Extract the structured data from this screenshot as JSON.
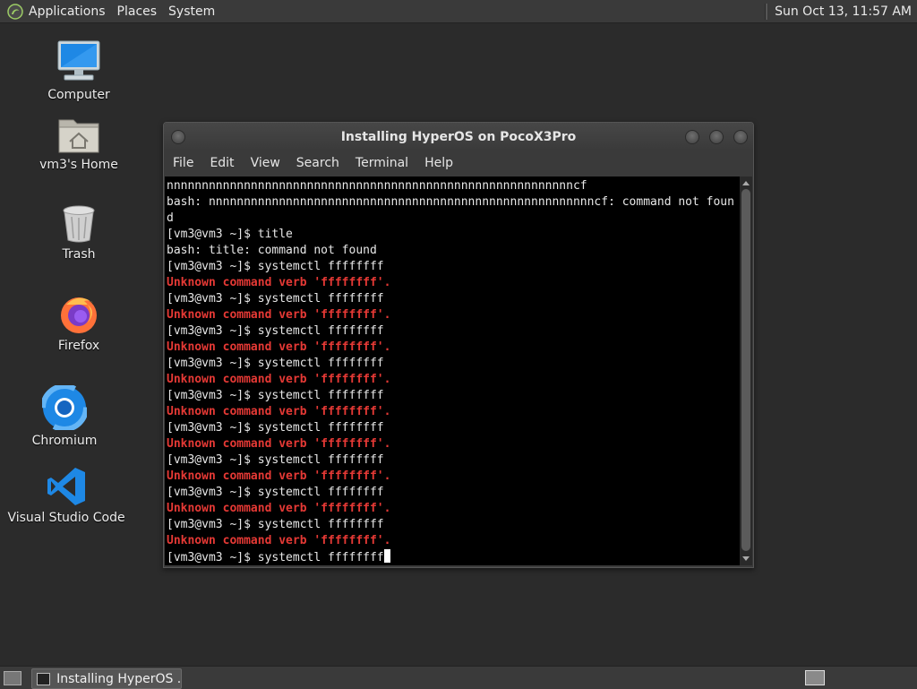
{
  "top_panel": {
    "menus": [
      "Applications",
      "Places",
      "System"
    ],
    "clock": "Sun Oct 13, 11:57 AM"
  },
  "desktop": {
    "icons": [
      {
        "label": "Computer",
        "icon": "computer-icon"
      },
      {
        "label": "vm3's Home",
        "icon": "home-folder-icon"
      },
      {
        "label": "Trash",
        "icon": "trash-icon"
      },
      {
        "label": "Firefox",
        "icon": "firefox-icon"
      },
      {
        "label": "Chromium",
        "icon": "chromium-icon"
      },
      {
        "label": "Visual Studio Code",
        "icon": "vscode-icon"
      }
    ]
  },
  "terminal": {
    "title": "Installing HyperOS on PocoX3Pro",
    "menu": [
      "File",
      "Edit",
      "View",
      "Search",
      "Terminal",
      "Help"
    ],
    "lines": [
      {
        "text": "nnnnnnnnnnnnnnnnnnnnnnnnnnnnnnnnnnnnnnnnnnnnnnnnnnnnnnnnnncf",
        "style": "normal"
      },
      {
        "text": "bash: nnnnnnnnnnnnnnnnnnnnnnnnnnnnnnnnnnnnnnnnnnnnnnnnnnnnnnncf: command not foun",
        "style": "normal"
      },
      {
        "text": "d",
        "style": "normal"
      },
      {
        "text": "[vm3@vm3 ~]$ title",
        "style": "normal"
      },
      {
        "text": "bash: title: command not found",
        "style": "normal"
      },
      {
        "text": "[vm3@vm3 ~]$ systemctl ffffffff",
        "style": "normal"
      },
      {
        "text": "Unknown command verb 'ffffffff'.",
        "style": "error"
      },
      {
        "text": "[vm3@vm3 ~]$ systemctl ffffffff",
        "style": "normal"
      },
      {
        "text": "Unknown command verb 'ffffffff'.",
        "style": "error"
      },
      {
        "text": "[vm3@vm3 ~]$ systemctl ffffffff",
        "style": "normal"
      },
      {
        "text": "Unknown command verb 'ffffffff'.",
        "style": "error"
      },
      {
        "text": "[vm3@vm3 ~]$ systemctl ffffffff",
        "style": "normal"
      },
      {
        "text": "Unknown command verb 'ffffffff'.",
        "style": "error"
      },
      {
        "text": "[vm3@vm3 ~]$ systemctl ffffffff",
        "style": "normal"
      },
      {
        "text": "Unknown command verb 'ffffffff'.",
        "style": "error"
      },
      {
        "text": "[vm3@vm3 ~]$ systemctl ffffffff",
        "style": "normal"
      },
      {
        "text": "Unknown command verb 'ffffffff'.",
        "style": "error"
      },
      {
        "text": "[vm3@vm3 ~]$ systemctl ffffffff",
        "style": "normal"
      },
      {
        "text": "Unknown command verb 'ffffffff'.",
        "style": "error"
      },
      {
        "text": "[vm3@vm3 ~]$ systemctl ffffffff",
        "style": "normal"
      },
      {
        "text": "Unknown command verb 'ffffffff'.",
        "style": "error"
      },
      {
        "text": "[vm3@vm3 ~]$ systemctl ffffffff",
        "style": "normal"
      },
      {
        "text": "Unknown command verb 'ffffffff'.",
        "style": "error"
      }
    ],
    "prompt_line": "[vm3@vm3 ~]$ systemctl ffffffff"
  },
  "bottom_panel": {
    "task_label": "Installing HyperOS ..."
  },
  "colors": {
    "error_text": "#e53935",
    "terminal_bg": "#000000",
    "panel_bg": "#3a3a3a",
    "desktop_bg": "#2b2b2b"
  }
}
